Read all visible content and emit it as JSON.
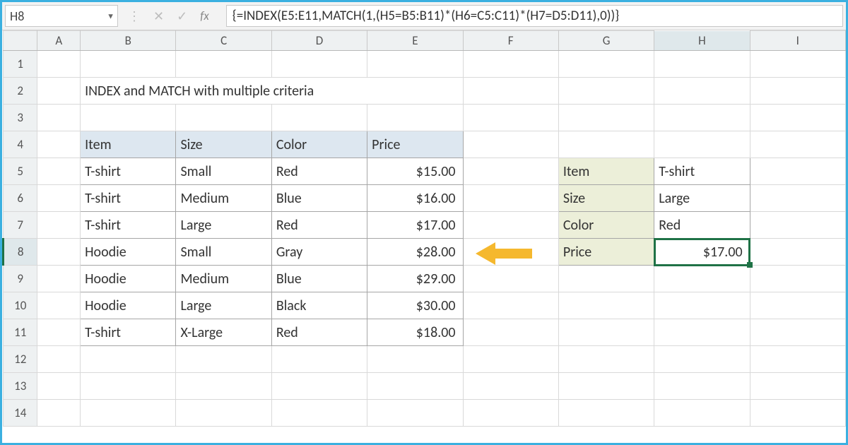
{
  "namebox": "H8",
  "formula": "{=INDEX(E5:E11,MATCH(1,(H5=B5:B11)*(H6=C5:C11)*(H7=D5:D11),0))}",
  "columns": [
    "A",
    "B",
    "C",
    "D",
    "E",
    "F",
    "G",
    "H",
    "I"
  ],
  "rows": [
    "1",
    "2",
    "3",
    "4",
    "5",
    "6",
    "7",
    "8",
    "9",
    "10",
    "11",
    "12",
    "13",
    "14"
  ],
  "title": "INDEX and MATCH with multiple criteria",
  "table1": {
    "headers": [
      "Item",
      "Size",
      "Color",
      "Price"
    ],
    "rows": [
      {
        "item": "T-shirt",
        "size": "Small",
        "color": "Red",
        "price": "$15.00"
      },
      {
        "item": "T-shirt",
        "size": "Medium",
        "color": "Blue",
        "price": "$16.00"
      },
      {
        "item": "T-shirt",
        "size": "Large",
        "color": "Red",
        "price": "$17.00"
      },
      {
        "item": "Hoodie",
        "size": "Small",
        "color": "Gray",
        "price": "$28.00"
      },
      {
        "item": "Hoodie",
        "size": "Medium",
        "color": "Blue",
        "price": "$29.00"
      },
      {
        "item": "Hoodie",
        "size": "Large",
        "color": "Black",
        "price": "$30.00"
      },
      {
        "item": "T-shirt",
        "size": "X-Large",
        "color": "Red",
        "price": "$18.00"
      }
    ]
  },
  "lookup": {
    "labels": {
      "item": "Item",
      "size": "Size",
      "color": "Color",
      "price": "Price"
    },
    "values": {
      "item": "T-shirt",
      "size": "Large",
      "color": "Red",
      "price": "$17.00"
    }
  },
  "icons": {
    "dropdown": "▼",
    "cancel": "✕",
    "enter": "✓",
    "dots": "⋮"
  },
  "fx_label": "fx",
  "selected_col": "H",
  "selected_row": "8"
}
